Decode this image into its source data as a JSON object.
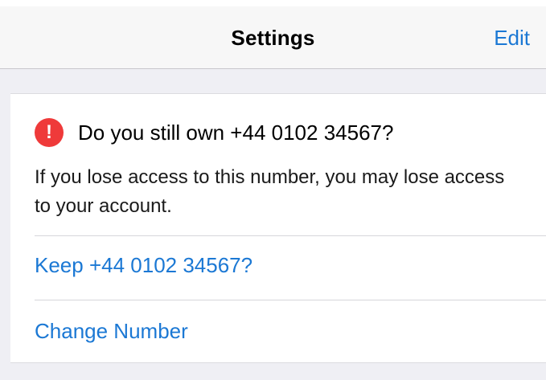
{
  "header": {
    "title": "Settings",
    "edit_label": "Edit"
  },
  "alert": {
    "icon_name": "exclamation-icon",
    "icon_glyph": "!",
    "title": "Do you still own +44 0102 34567?",
    "body": "If you lose access to this number, you may lose access to your account."
  },
  "actions": {
    "keep_label": "Keep +44 0102 34567?",
    "change_label": "Change Number"
  },
  "colors": {
    "accent": "#1b78d4",
    "alert_red": "#ef3a3a",
    "background": "#efeff4"
  }
}
